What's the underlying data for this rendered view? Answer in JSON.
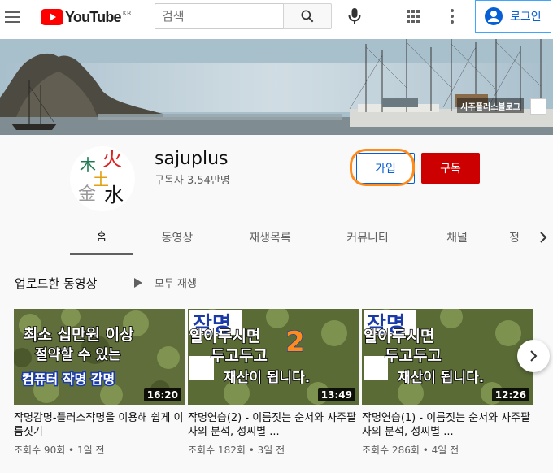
{
  "header": {
    "logo_text": "YouTube",
    "region": "KR",
    "search_placeholder": "검색",
    "login_label": "로그인"
  },
  "banner": {
    "blog_badge": "사주플러스블로그"
  },
  "channel": {
    "name": "sajuplus",
    "subscribers": "구독자 3.54만명",
    "join_label": "가입",
    "subscribe_label": "구독",
    "avatar_chars": [
      "木",
      "火",
      "土",
      "金",
      "水"
    ]
  },
  "tabs": [
    {
      "label": "홈"
    },
    {
      "label": "동영상"
    },
    {
      "label": "재생목록"
    },
    {
      "label": "커뮤니티"
    },
    {
      "label": "채널"
    },
    {
      "label": "정"
    }
  ],
  "section": {
    "title": "업로드한 동영상",
    "play_all": "모두 재생"
  },
  "videos": [
    {
      "duration": "16:20",
      "title": "작명감명-플러스작명을 이용해 쉽게 이름짓기",
      "meta": "조회수 90회 • 1일 전",
      "overlay": [
        "최소 십만원 이상",
        "절약할 수 있는",
        "컴퓨터 작명 감명"
      ]
    },
    {
      "duration": "13:49",
      "title": "작명연습(2) - 이름짓는 순서와 사주팔자의 분석, 성씨별 ...",
      "meta": "조회수 182회 • 3일 전",
      "overlay": [
        "작명",
        "알아두시면",
        "두고두고",
        "재산이 됩니다.",
        "2"
      ]
    },
    {
      "duration": "12:26",
      "title": "작명연습(1) - 이름짓는 순서와 사주팔자의 분석, 성씨별 ...",
      "meta": "조회수 286회 • 4일 전",
      "overlay": [
        "작명",
        "알아두시면",
        "두고두고",
        "재산이 됩니다."
      ]
    }
  ],
  "colors": {
    "brand_red": "#ff0000",
    "subscribe_red": "#cc0000",
    "link_blue": "#065fd4",
    "highlight_orange": "#ff8c1a"
  }
}
